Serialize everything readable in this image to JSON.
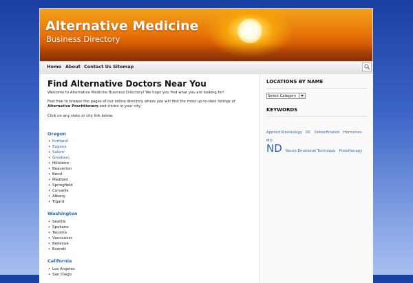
{
  "site": {
    "title": "Alternative Medicine",
    "description": "Business Directory"
  },
  "nav": {
    "items": [
      "Home",
      "About",
      "Contact Us",
      "Sitemap"
    ],
    "search_icon": "magnifier-icon"
  },
  "main": {
    "page_title": "Find Alternative Doctors Near You",
    "intro": "Welcome to Alternative Medicine Business Directory! We hope you find what you are looking for!",
    "browse_pre": "Feel free to browse the pages of our online directory where you will find the most up-to-date listings of",
    "browse_bold": "Alternative Practitioners",
    "browse_post": " and clinics in your city.",
    "click_note": "Click on any state or city link below.",
    "states": [
      {
        "name": "Oregon",
        "cities": [
          {
            "name": "Portland",
            "link": true
          },
          {
            "name": "Eugene",
            "link": true
          },
          {
            "name": "Salem",
            "link": true
          },
          {
            "name": "Gresham",
            "link": true
          },
          {
            "name": "Hillsboro",
            "link": false
          },
          {
            "name": "Beaverton",
            "link": false
          },
          {
            "name": "Bend",
            "link": false
          },
          {
            "name": "Medford",
            "link": false
          },
          {
            "name": "Springfield",
            "link": false
          },
          {
            "name": "Corvallis",
            "link": false
          },
          {
            "name": "Albany",
            "link": false
          },
          {
            "name": "Tigard",
            "link": false
          }
        ]
      },
      {
        "name": "Washington",
        "cities": [
          {
            "name": "Seattle",
            "link": false
          },
          {
            "name": "Spokane",
            "link": false
          },
          {
            "name": "Tacoma",
            "link": false
          },
          {
            "name": "Vancouver",
            "link": false
          },
          {
            "name": "Bellevue",
            "link": false
          },
          {
            "name": "Everett",
            "link": false
          }
        ]
      },
      {
        "name": "California",
        "cities": [
          {
            "name": "Los Angeles",
            "link": false
          },
          {
            "name": "San Diego",
            "link": false
          }
        ]
      }
    ]
  },
  "sidebar": {
    "locations_title": "LOCATIONS BY NAME",
    "select_value": "Select Category",
    "keywords_title": "KEYWORDS",
    "tags": [
      {
        "label": "Applied Kinesiology",
        "big": false
      },
      {
        "label": "DC",
        "big": false
      },
      {
        "label": "Detoxification",
        "big": false
      },
      {
        "label": "Hormones",
        "big": false
      },
      {
        "label": "MD",
        "big": false
      },
      {
        "label": "ND",
        "big": true
      },
      {
        "label": "Neuro Emotional Technique",
        "big": false
      },
      {
        "label": "Prolotherapy",
        "big": false
      }
    ]
  },
  "colors": {
    "link": "#2a64b0",
    "background_top": "#1a3fa3",
    "background_bottom": "#a9bff0"
  }
}
